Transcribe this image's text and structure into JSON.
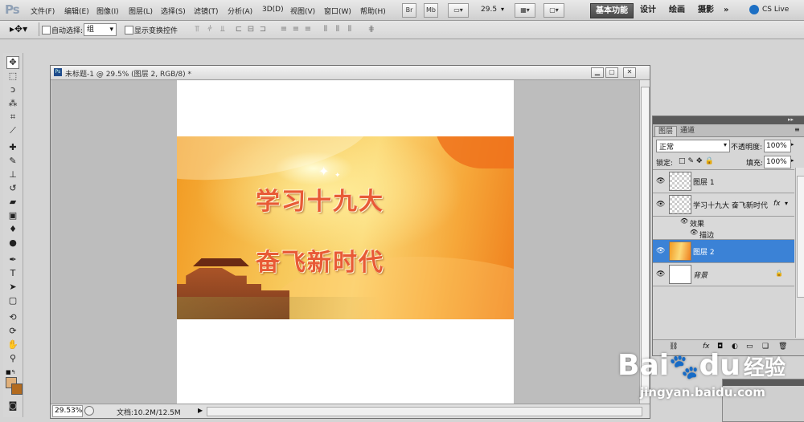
{
  "app": {
    "logo": "Ps"
  },
  "menu": [
    "文件(F)",
    "编辑(E)",
    "图像(I)",
    "图层(L)",
    "选择(S)",
    "滤镜(T)",
    "分析(A)",
    "3D(D)",
    "视图(V)",
    "窗口(W)",
    "帮助(H)"
  ],
  "appbar": {
    "br_label": "Br",
    "mb_label": "Mb",
    "zoom_value": "29.5"
  },
  "workspaces": {
    "active": "基本功能",
    "design": "设计",
    "painting": "绘画",
    "photography": "摄影",
    "more": "»",
    "cs_live": "CS Live"
  },
  "options": {
    "auto_select_label": "自动选择:",
    "auto_select_value": "组",
    "transform_label": "显示变换控件"
  },
  "document": {
    "title": "未标题-1 @ 29.5% (图层 2, RGB/8) *",
    "slogan_line1": "学习十九大",
    "slogan_line2": "奋飞新时代",
    "zoom_status": "29.53%",
    "doc_info": "文档:10.2M/12.5M"
  },
  "layers_panel": {
    "tabs": [
      "图层",
      "通道"
    ],
    "blend_mode": "正常",
    "opacity_label": "不透明度:",
    "opacity_value": "100%",
    "lock_label": "锁定:",
    "fill_label": "填充:",
    "fill_value": "100%",
    "layers": [
      {
        "name": "图层 1"
      },
      {
        "name": "学习十九大 奋飞新时代",
        "fx": "fx"
      },
      {
        "name": "效果"
      },
      {
        "name": "描边"
      },
      {
        "name": "图层 2"
      },
      {
        "name": "背景"
      }
    ]
  },
  "watermark": {
    "brand": "Bai",
    "brand2": "du",
    "jingyan": "经验",
    "url": "jingyan.baidu.com"
  },
  "colors": {
    "accent_selected_layer": "#3b82d6",
    "banner_orange": "#f29a22",
    "slogan_red": "#e85a36"
  }
}
